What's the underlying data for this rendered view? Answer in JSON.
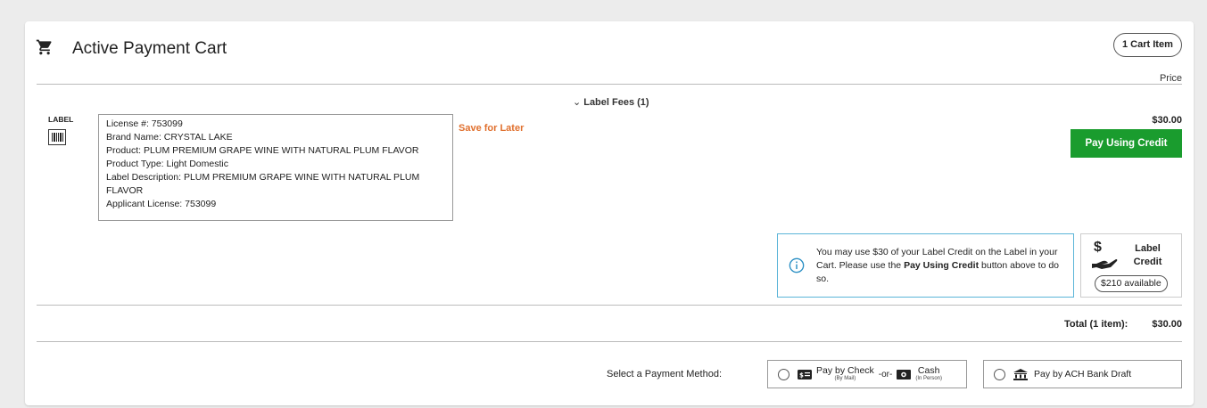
{
  "header": {
    "title": "Active Payment Cart",
    "cart_badge": "1 Cart Item",
    "price_column": "Price"
  },
  "section": {
    "chevron": "⌄",
    "toggle_label": "Label Fees (1)"
  },
  "item": {
    "tag": "LABEL",
    "icon": "barcode-icon",
    "details": [
      "License #: 753099",
      "Brand Name: CRYSTAL LAKE",
      "Product: PLUM PREMIUM GRAPE WINE WITH NATURAL PLUM FLAVOR",
      "Product Type: Light Domestic",
      "Label Description: PLUM PREMIUM GRAPE WINE WITH NATURAL PLUM FLAVOR",
      "Applicant License: 753099"
    ],
    "save_for_later": "Save for Later",
    "price": "$30.00",
    "pay_credit_button": "Pay Using Credit"
  },
  "info": {
    "text_before": "You may use $30 of your Label Credit on the Label in your Cart. Please use the ",
    "text_bold": "Pay Using Credit",
    "text_after": " button above to do so."
  },
  "credit": {
    "symbol": "$",
    "label": "Label Credit",
    "available": "$210 available"
  },
  "totals": {
    "label": "Total (1 item):",
    "value": "$30.00"
  },
  "payment": {
    "label": "Select a Payment Method:",
    "check_main": "Pay by Check",
    "check_sub": "(By Mail)",
    "or": "-or-",
    "cash_main": "Cash",
    "cash_sub": "(In Person)",
    "ach": "Pay by ACH Bank Draft"
  },
  "colors": {
    "accent_green": "#1a9c2e",
    "save_orange": "#e0702e",
    "info_border": "#5bb5d8"
  }
}
